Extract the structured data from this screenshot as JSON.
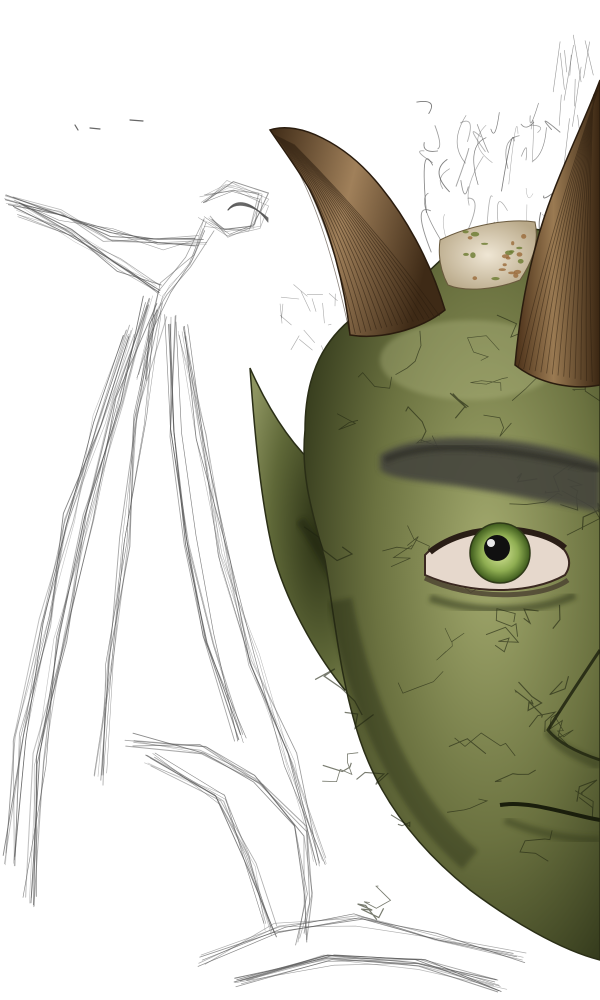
{
  "artwork": {
    "subject": "horned-green-creature-face",
    "background_color": "#ffffff",
    "colors": {
      "skin": "#6b7240",
      "skin_shadow": "#2e3418",
      "skin_highlight": "#a3aa6e",
      "horn": "#6e4e2e",
      "horn_dark": "#3e2a16",
      "horn_light": "#a0805a",
      "brow": "#45443e",
      "iris": "#8fae52",
      "pupil": "#101010",
      "eye_white": "#e6d8cc",
      "sketch_line": "#555555",
      "crown_patch": "#dcd0b8"
    },
    "elements": {
      "sketch": "bird-pencil-sketch",
      "head": "creature-head",
      "horns": 2,
      "ear": "pointed-ear",
      "eye": "green-eye"
    }
  }
}
